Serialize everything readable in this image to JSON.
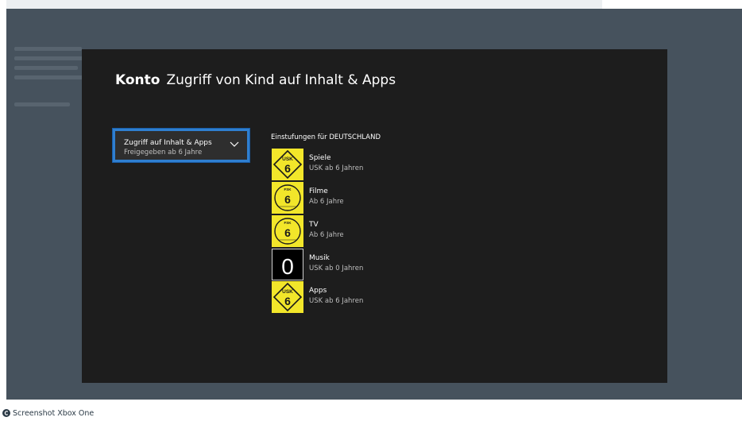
{
  "page": {
    "title_bold": "Konto",
    "title": "Zugriff von Kind auf Inhalt & Apps"
  },
  "dropdown": {
    "label": "Zugriff auf Inhalt & Apps",
    "value": "Freigegeben ab 6 Jahre"
  },
  "ratings": {
    "heading": "Einstufungen für DEUTSCHLAND",
    "items": [
      {
        "name": "Spiele",
        "value": "USK ab 6 Jahren",
        "badge": "usk-6-icon",
        "badge_text": "USK",
        "number": "6"
      },
      {
        "name": "Filme",
        "value": "Ab 6 Jahre",
        "badge": "fsk-6-icon",
        "badge_text": "FSK",
        "number": "6"
      },
      {
        "name": "TV",
        "value": "Ab 6 Jahre",
        "badge": "fsk-6-icon",
        "badge_text": "FSK",
        "number": "6"
      },
      {
        "name": "Musik",
        "value": "USK ab 0 Jahren",
        "badge": "rating-0-icon",
        "badge_text": "",
        "number": "0"
      },
      {
        "name": "Apps",
        "value": "USK ab 6 Jahren",
        "badge": "usk-6-icon",
        "badge_text": "USK",
        "number": "6"
      }
    ]
  },
  "caption": {
    "text": "Screenshot Xbox One"
  },
  "colors": {
    "focus_border": "#2f7fd0",
    "panel_bg": "#1d1d1d",
    "backdrop": "#46525d",
    "badge_yellow": "#f2e62a"
  }
}
